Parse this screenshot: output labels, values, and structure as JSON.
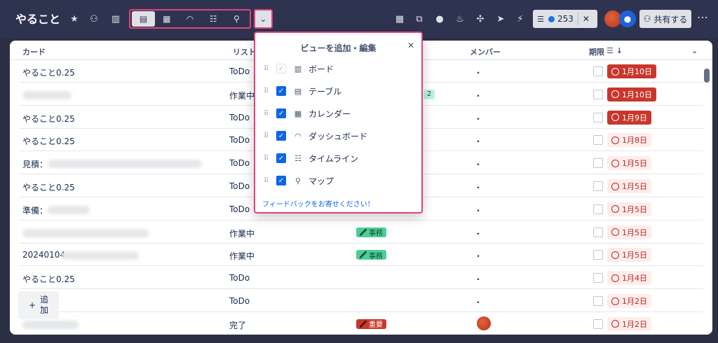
{
  "board": {
    "title": "やること"
  },
  "header": {
    "filter_count": "253",
    "share_label": "共有する",
    "add_label_line1": "追",
    "add_label_line2": "加"
  },
  "table": {
    "columns": {
      "card": "カード",
      "list": "リスト",
      "members": "メンバー",
      "due": "期限"
    },
    "rows": [
      {
        "card": "やること0.25",
        "list": "ToDo",
        "label": "",
        "member": "・",
        "due": "1月10日",
        "due_status": "overdue"
      },
      {
        "card": "",
        "list": "作業中",
        "label": "2",
        "member": "・",
        "due": "1月10日",
        "due_status": "overdue"
      },
      {
        "card": "やること0.25",
        "list": "ToDo",
        "label": "",
        "member": "・",
        "due": "1月9日",
        "due_status": "overdue"
      },
      {
        "card": "やること0.25",
        "list": "ToDo",
        "label": "",
        "member": "・",
        "due": "1月8日",
        "due_status": "soon"
      },
      {
        "card": "見積：",
        "list": "ToDo",
        "label": "",
        "member": "・",
        "due": "1月5日",
        "due_status": "soon"
      },
      {
        "card": "やること0.25",
        "list": "ToDo",
        "label": "",
        "member": "・",
        "due": "1月5日",
        "due_status": "soon"
      },
      {
        "card": "準備：",
        "list": "ToDo",
        "label": "",
        "member": "・",
        "due": "1月5日",
        "due_status": "soon"
      },
      {
        "card": "",
        "list": "作業中",
        "label": "事務",
        "member": "・",
        "due": "1月5日",
        "due_status": "soon"
      },
      {
        "card": "20240104",
        "list": "作業中",
        "label": "事務",
        "member": "・",
        "due": "1月5日",
        "due_status": "soon"
      },
      {
        "card": "やること0.25",
        "list": "ToDo",
        "label": "",
        "member": "・",
        "due": "1月4日",
        "due_status": "soon"
      },
      {
        "card": "25",
        "list": "ToDo",
        "label": "",
        "member": "・",
        "due": "1月2日",
        "due_status": "soon"
      },
      {
        "card": "",
        "list": "完了",
        "label": "重要",
        "member": "",
        "due": "1月2日",
        "due_status": "soon"
      }
    ]
  },
  "popover": {
    "title": "ビューを追加・編集",
    "items": [
      {
        "label": "ボード",
        "checked": true,
        "disabled": true
      },
      {
        "label": "テーブル",
        "checked": true,
        "disabled": false
      },
      {
        "label": "カレンダー",
        "checked": true,
        "disabled": false
      },
      {
        "label": "ダッシュボード",
        "checked": true,
        "disabled": false
      },
      {
        "label": "タイムライン",
        "checked": true,
        "disabled": false
      },
      {
        "label": "マップ",
        "checked": true,
        "disabled": false
      }
    ],
    "feedback": "フィードバックをお寄せください！"
  },
  "colors": {
    "header_bg": "#2e3350",
    "highlight_border": "#e0437a",
    "overdue": "#c9372c",
    "due_soon_bg": "#ffeceb",
    "label_green": "#4bce97",
    "label_red": "#c9372c"
  }
}
